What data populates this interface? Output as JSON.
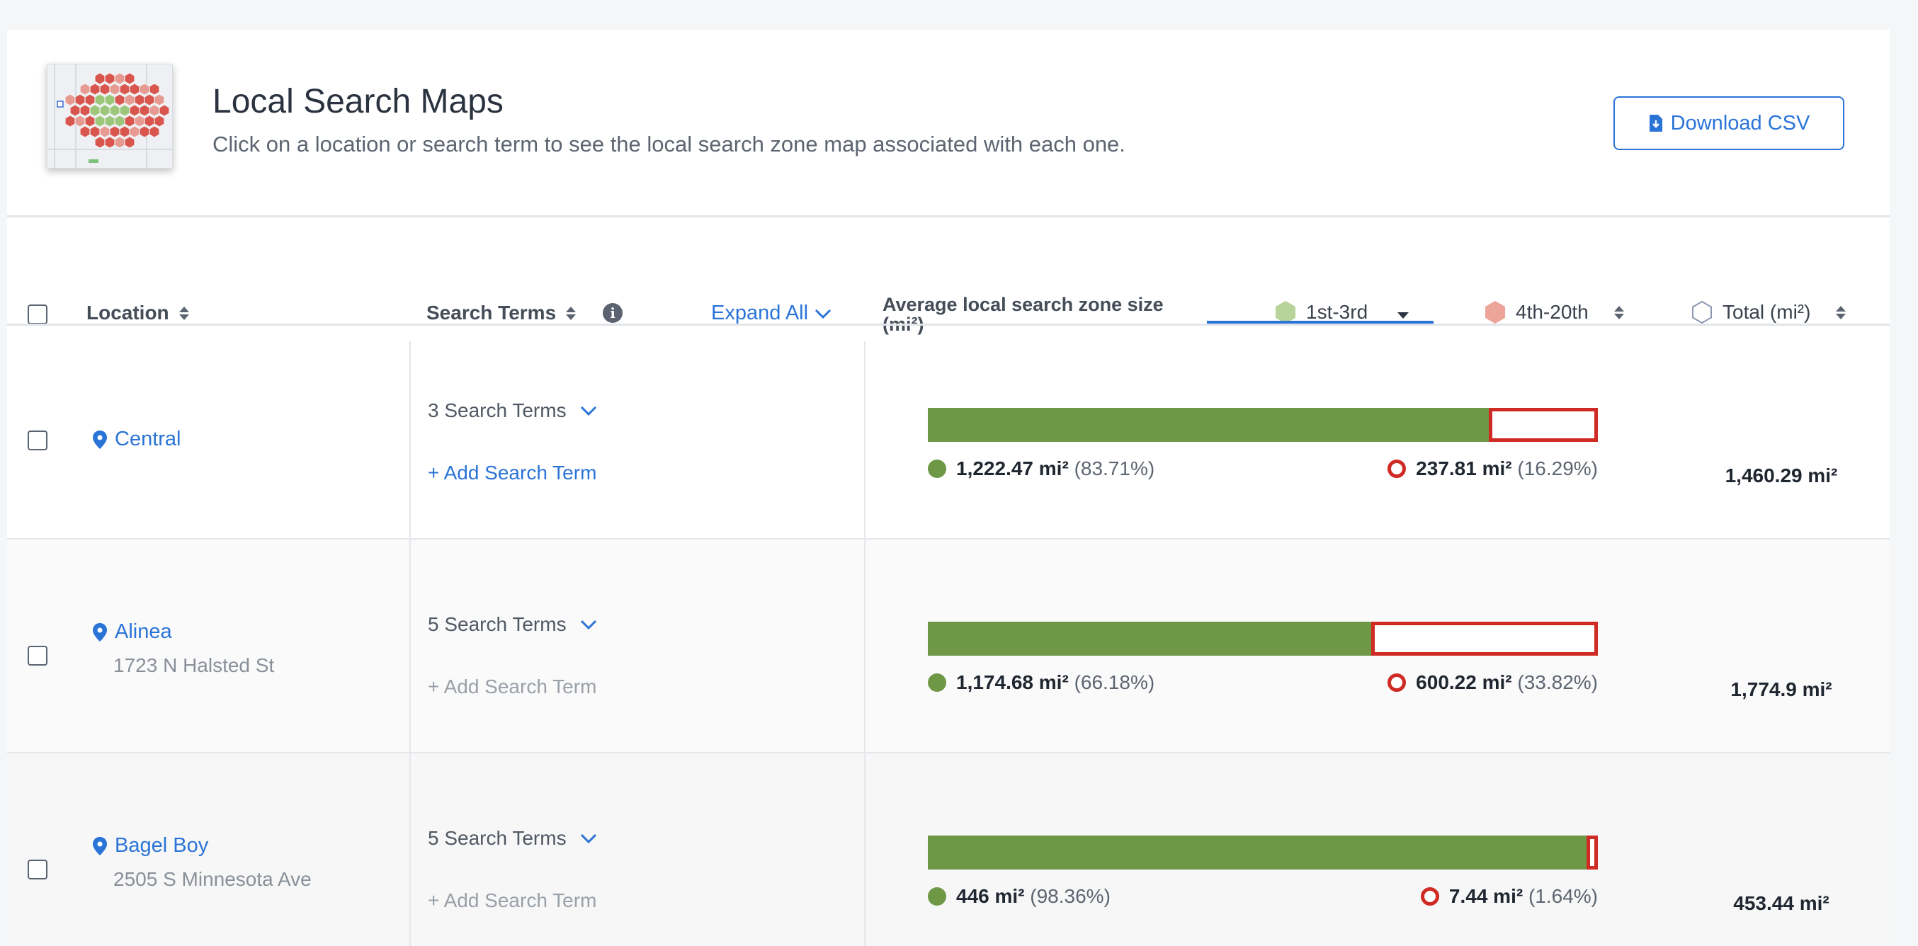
{
  "header": {
    "title": "Local Search Maps",
    "subtitle": "Click on a location or search term to see the local search zone map associated with each one.",
    "download_label": "Download CSV"
  },
  "table_header": {
    "location": "Location",
    "search_terms": "Search Terms",
    "expand_all": "Expand All",
    "avg_zone": "Average local search zone size (mi²)",
    "rank_top": "1st-3rd",
    "rank_mid": "4th-20th",
    "total": "Total (mi²)"
  },
  "colors": {
    "accent": "#2a74d8",
    "good": "#6e9846",
    "bad": "#cf2b24"
  },
  "rows": [
    {
      "name": "Central",
      "address": "",
      "terms": "3 Search Terms",
      "add_term": "+ Add Search Term",
      "good_value": "1,222.47 mi²",
      "good_pct": "(83.71%)",
      "good_fraction": 0.8371,
      "bad_value": "237.81 mi²",
      "bad_pct": "(16.29%)",
      "total": "1,460.29 mi²"
    },
    {
      "name": "Alinea",
      "address": "1723 N Halsted St",
      "terms": "5 Search Terms",
      "add_term": "+ Add Search Term",
      "good_value": "1,174.68 mi²",
      "good_pct": "(66.18%)",
      "good_fraction": 0.6618,
      "bad_value": "600.22 mi²",
      "bad_pct": "(33.82%)",
      "total": "1,774.9 mi²"
    },
    {
      "name": "Bagel Boy",
      "address": "2505 S Minnesota Ave",
      "terms": "5 Search Terms",
      "add_term": "+ Add Search Term",
      "good_value": "446 mi²",
      "good_pct": "(98.36%)",
      "good_fraction": 0.9836,
      "bad_value": "7.44 mi²",
      "bad_pct": "(1.64%)",
      "total": "453.44 mi²"
    }
  ]
}
